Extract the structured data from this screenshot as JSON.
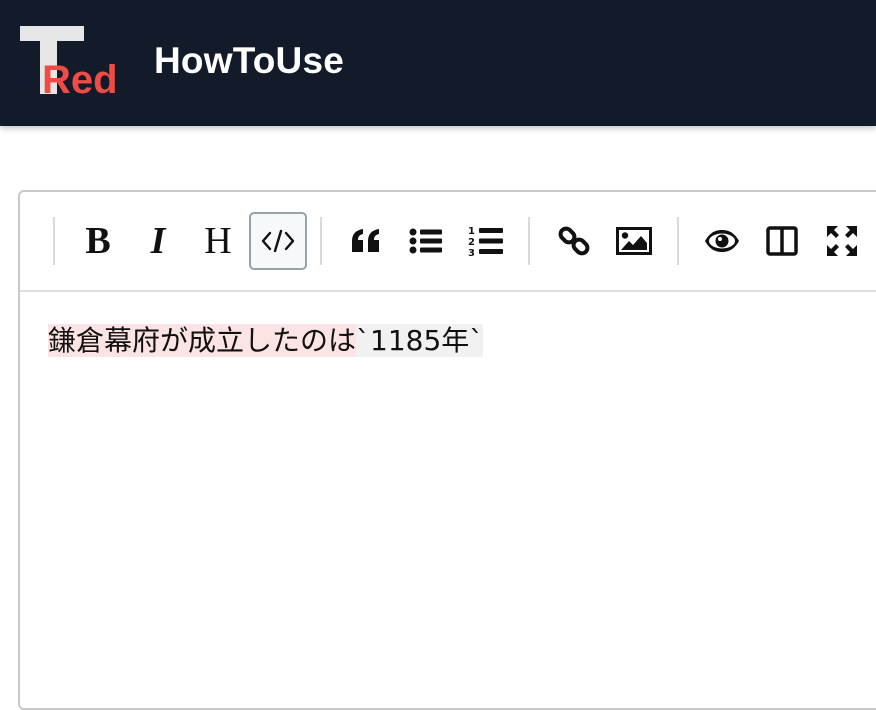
{
  "app": {
    "logo": {
      "top_letter": "T",
      "text": "Red",
      "colors": {
        "letter": "#e6e6e6",
        "text": "#ef4c45"
      }
    },
    "title": "HowToUse"
  },
  "toolbar": {
    "buttons": [
      {
        "name": "bold",
        "label": "B",
        "icon": "bold-icon"
      },
      {
        "name": "italic",
        "label": "I",
        "icon": "italic-icon"
      },
      {
        "name": "heading",
        "label": "H",
        "icon": "heading-icon"
      },
      {
        "name": "code",
        "icon": "code-icon",
        "active": true
      },
      {
        "name": "quote",
        "icon": "quote-icon"
      },
      {
        "name": "unordered-list",
        "icon": "unordered-list-icon"
      },
      {
        "name": "ordered-list",
        "icon": "ordered-list-icon"
      },
      {
        "name": "link",
        "icon": "link-icon"
      },
      {
        "name": "image",
        "icon": "image-icon"
      },
      {
        "name": "preview",
        "icon": "eye-icon"
      },
      {
        "name": "side-by-side",
        "icon": "columns-icon"
      },
      {
        "name": "fullscreen",
        "icon": "fullscreen-icon"
      }
    ]
  },
  "editor": {
    "text_main": "鎌倉幕府が成立したのは",
    "text_code": "`1185年`"
  },
  "colors": {
    "topbar_bg": "#131a2a",
    "active_border": "#97a2a8",
    "highlight_pink": "#fde4e4",
    "highlight_gray": "#f1f1f1"
  }
}
